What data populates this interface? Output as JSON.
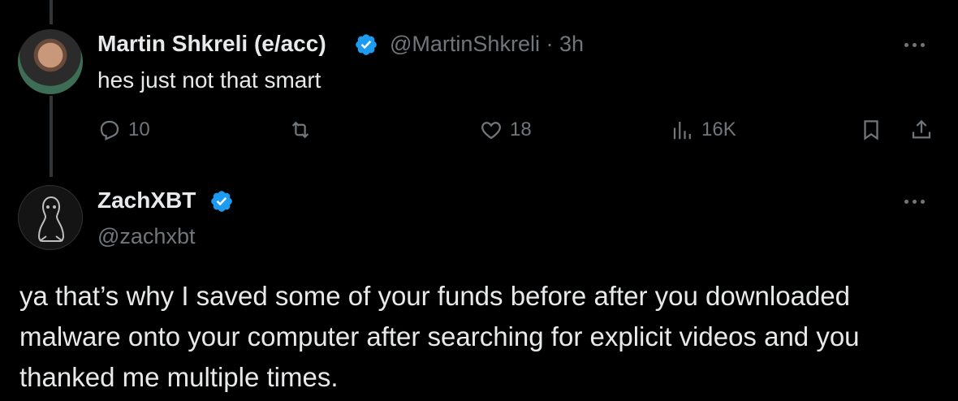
{
  "colors": {
    "background": "#000000",
    "text": "#e7e9ea",
    "muted": "#71767b",
    "verified": "#1d9bf0"
  },
  "parent_tweet": {
    "display_name": "Martin Shkreli (e/acc)",
    "handle_time": "@MartinShkreli · 3h",
    "text": "hes just not that smart",
    "metrics": {
      "replies": "10",
      "likes": "18",
      "views": "16K"
    }
  },
  "reply_tweet": {
    "display_name": "ZachXBT",
    "handle": "@zachxbt",
    "text_lines": [
      "ya that’s why I saved some of your funds before after you downloaded",
      "malware onto your computer after searching for explicit videos and you",
      "thanked me multiple times."
    ]
  },
  "icons": [
    "reply-icon",
    "retweet-icon",
    "like-icon",
    "views-icon",
    "bookmark-icon",
    "share-icon",
    "more-icon",
    "verified-badge-icon"
  ]
}
